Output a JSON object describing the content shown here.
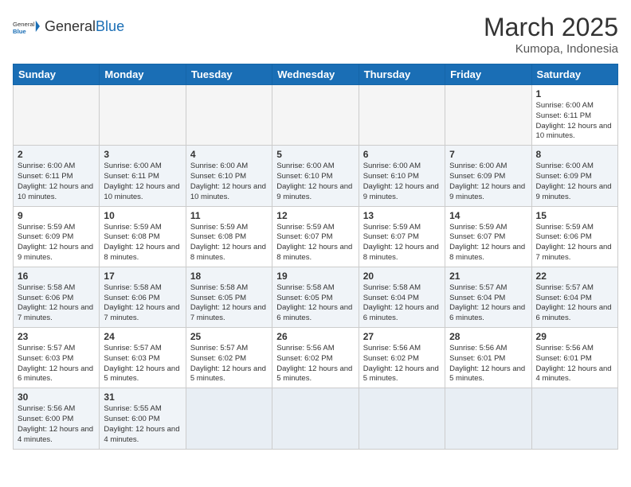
{
  "header": {
    "logo_general": "General",
    "logo_blue": "Blue",
    "month": "March 2025",
    "location": "Kumopa, Indonesia"
  },
  "days_of_week": [
    "Sunday",
    "Monday",
    "Tuesday",
    "Wednesday",
    "Thursday",
    "Friday",
    "Saturday"
  ],
  "weeks": [
    {
      "alt": false,
      "days": [
        {
          "num": "",
          "info": ""
        },
        {
          "num": "",
          "info": ""
        },
        {
          "num": "",
          "info": ""
        },
        {
          "num": "",
          "info": ""
        },
        {
          "num": "",
          "info": ""
        },
        {
          "num": "",
          "info": ""
        },
        {
          "num": "1",
          "info": "Sunrise: 6:00 AM\nSunset: 6:11 PM\nDaylight: 12 hours and 10 minutes."
        }
      ]
    },
    {
      "alt": true,
      "days": [
        {
          "num": "2",
          "info": "Sunrise: 6:00 AM\nSunset: 6:11 PM\nDaylight: 12 hours and 10 minutes."
        },
        {
          "num": "3",
          "info": "Sunrise: 6:00 AM\nSunset: 6:11 PM\nDaylight: 12 hours and 10 minutes."
        },
        {
          "num": "4",
          "info": "Sunrise: 6:00 AM\nSunset: 6:10 PM\nDaylight: 12 hours and 10 minutes."
        },
        {
          "num": "5",
          "info": "Sunrise: 6:00 AM\nSunset: 6:10 PM\nDaylight: 12 hours and 9 minutes."
        },
        {
          "num": "6",
          "info": "Sunrise: 6:00 AM\nSunset: 6:10 PM\nDaylight: 12 hours and 9 minutes."
        },
        {
          "num": "7",
          "info": "Sunrise: 6:00 AM\nSunset: 6:09 PM\nDaylight: 12 hours and 9 minutes."
        },
        {
          "num": "8",
          "info": "Sunrise: 6:00 AM\nSunset: 6:09 PM\nDaylight: 12 hours and 9 minutes."
        }
      ]
    },
    {
      "alt": false,
      "days": [
        {
          "num": "9",
          "info": "Sunrise: 5:59 AM\nSunset: 6:09 PM\nDaylight: 12 hours and 9 minutes."
        },
        {
          "num": "10",
          "info": "Sunrise: 5:59 AM\nSunset: 6:08 PM\nDaylight: 12 hours and 8 minutes."
        },
        {
          "num": "11",
          "info": "Sunrise: 5:59 AM\nSunset: 6:08 PM\nDaylight: 12 hours and 8 minutes."
        },
        {
          "num": "12",
          "info": "Sunrise: 5:59 AM\nSunset: 6:07 PM\nDaylight: 12 hours and 8 minutes."
        },
        {
          "num": "13",
          "info": "Sunrise: 5:59 AM\nSunset: 6:07 PM\nDaylight: 12 hours and 8 minutes."
        },
        {
          "num": "14",
          "info": "Sunrise: 5:59 AM\nSunset: 6:07 PM\nDaylight: 12 hours and 8 minutes."
        },
        {
          "num": "15",
          "info": "Sunrise: 5:59 AM\nSunset: 6:06 PM\nDaylight: 12 hours and 7 minutes."
        }
      ]
    },
    {
      "alt": true,
      "days": [
        {
          "num": "16",
          "info": "Sunrise: 5:58 AM\nSunset: 6:06 PM\nDaylight: 12 hours and 7 minutes."
        },
        {
          "num": "17",
          "info": "Sunrise: 5:58 AM\nSunset: 6:06 PM\nDaylight: 12 hours and 7 minutes."
        },
        {
          "num": "18",
          "info": "Sunrise: 5:58 AM\nSunset: 6:05 PM\nDaylight: 12 hours and 7 minutes."
        },
        {
          "num": "19",
          "info": "Sunrise: 5:58 AM\nSunset: 6:05 PM\nDaylight: 12 hours and 6 minutes."
        },
        {
          "num": "20",
          "info": "Sunrise: 5:58 AM\nSunset: 6:04 PM\nDaylight: 12 hours and 6 minutes."
        },
        {
          "num": "21",
          "info": "Sunrise: 5:57 AM\nSunset: 6:04 PM\nDaylight: 12 hours and 6 minutes."
        },
        {
          "num": "22",
          "info": "Sunrise: 5:57 AM\nSunset: 6:04 PM\nDaylight: 12 hours and 6 minutes."
        }
      ]
    },
    {
      "alt": false,
      "days": [
        {
          "num": "23",
          "info": "Sunrise: 5:57 AM\nSunset: 6:03 PM\nDaylight: 12 hours and 6 minutes."
        },
        {
          "num": "24",
          "info": "Sunrise: 5:57 AM\nSunset: 6:03 PM\nDaylight: 12 hours and 5 minutes."
        },
        {
          "num": "25",
          "info": "Sunrise: 5:57 AM\nSunset: 6:02 PM\nDaylight: 12 hours and 5 minutes."
        },
        {
          "num": "26",
          "info": "Sunrise: 5:56 AM\nSunset: 6:02 PM\nDaylight: 12 hours and 5 minutes."
        },
        {
          "num": "27",
          "info": "Sunrise: 5:56 AM\nSunset: 6:02 PM\nDaylight: 12 hours and 5 minutes."
        },
        {
          "num": "28",
          "info": "Sunrise: 5:56 AM\nSunset: 6:01 PM\nDaylight: 12 hours and 5 minutes."
        },
        {
          "num": "29",
          "info": "Sunrise: 5:56 AM\nSunset: 6:01 PM\nDaylight: 12 hours and 4 minutes."
        }
      ]
    },
    {
      "alt": true,
      "days": [
        {
          "num": "30",
          "info": "Sunrise: 5:56 AM\nSunset: 6:00 PM\nDaylight: 12 hours and 4 minutes."
        },
        {
          "num": "31",
          "info": "Sunrise: 5:55 AM\nSunset: 6:00 PM\nDaylight: 12 hours and 4 minutes."
        },
        {
          "num": "",
          "info": ""
        },
        {
          "num": "",
          "info": ""
        },
        {
          "num": "",
          "info": ""
        },
        {
          "num": "",
          "info": ""
        },
        {
          "num": "",
          "info": ""
        }
      ]
    }
  ]
}
